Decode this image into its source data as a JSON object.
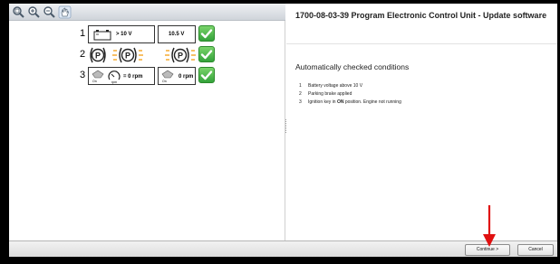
{
  "toolbar": {
    "icons": [
      "zoom-fit-icon",
      "zoom-in-icon",
      "zoom-out-icon",
      "pan-hand-icon"
    ]
  },
  "conditions_panel": {
    "rows": [
      {
        "number": "1",
        "value_label": "> 10 V",
        "measured": "10.5 V",
        "status": "ok"
      },
      {
        "number": "2",
        "status": "ok"
      },
      {
        "number": "3",
        "rpm_label": "= 0 rpm",
        "measured": "0 rpm",
        "on_label": "On",
        "rpm_unit": "rpm",
        "status": "ok"
      }
    ]
  },
  "task": {
    "title": "1700-08-03-39 Program Electronic Control Unit - Update software",
    "section_heading": "Automatically checked conditions",
    "conditions": [
      {
        "number": "1",
        "text": "Battery voltage above 10 V"
      },
      {
        "number": "2",
        "text": "Parking brake applied"
      },
      {
        "number": "3",
        "text_before": "Ignition key in ",
        "text_bold": "ON",
        "text_after": " position. Engine not running"
      }
    ]
  },
  "footer": {
    "continue_label": "Continue >",
    "cancel_label": "Cancel"
  },
  "colors": {
    "check_green": "#34a23a",
    "amber": "#f5a623",
    "annotation_red": "#e01010"
  }
}
